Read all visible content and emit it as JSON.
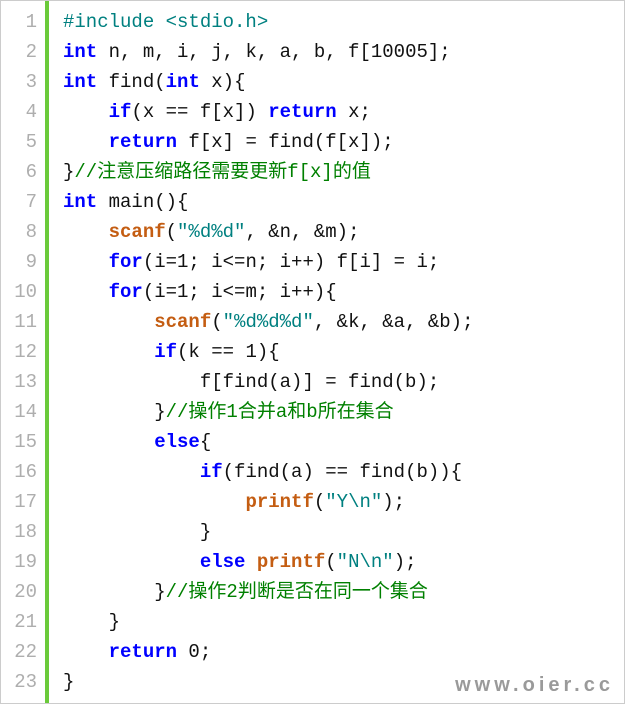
{
  "line_numbers": [
    "1",
    "2",
    "3",
    "4",
    "5",
    "6",
    "7",
    "8",
    "9",
    "10",
    "11",
    "12",
    "13",
    "14",
    "15",
    "16",
    "17",
    "18",
    "19",
    "20",
    "21",
    "22",
    "23"
  ],
  "watermark": "www.oier.cc",
  "code": {
    "l1": {
      "a": "#include",
      "b": " <stdio.h>"
    },
    "l2": {
      "a": "int",
      "b": " n, m, i, j, k, a, b, f[10005];"
    },
    "l3": {
      "a": "int",
      "b": " find(",
      "c": "int",
      "d": " x){"
    },
    "l4": {
      "a": "    ",
      "b": "if",
      "c": "(x == f[x]) ",
      "d": "return",
      "e": " x;"
    },
    "l5": {
      "a": "    ",
      "b": "return",
      "c": " f[x] = find(f[x]);"
    },
    "l6": {
      "a": "}",
      "b": "//注意压缩路径需要更新f[x]的值"
    },
    "l7": {
      "a": "int",
      "b": " main(){"
    },
    "l8": {
      "a": "    ",
      "b": "scanf",
      "c": "(",
      "d": "\"%d%d\"",
      "e": ", &n, &m);"
    },
    "l9": {
      "a": "    ",
      "b": "for",
      "c": "(i=1; i<=n; i++) f[i] = i;"
    },
    "l10": {
      "a": "    ",
      "b": "for",
      "c": "(i=1; i<=m; i++){"
    },
    "l11": {
      "a": "        ",
      "b": "scanf",
      "c": "(",
      "d": "\"%d%d%d\"",
      "e": ", &k, &a, &b);"
    },
    "l12": {
      "a": "        ",
      "b": "if",
      "c": "(k == 1){"
    },
    "l13": {
      "a": "            f[find(a)] = find(b);"
    },
    "l14": {
      "a": "        }",
      "b": "//操作1合并a和b所在集合"
    },
    "l15": {
      "a": "        ",
      "b": "else",
      "c": "{"
    },
    "l16": {
      "a": "            ",
      "b": "if",
      "c": "(find(a) == find(b)){"
    },
    "l17": {
      "a": "                ",
      "b": "printf",
      "c": "(",
      "d": "\"Y\\n\"",
      "e": ");"
    },
    "l18": {
      "a": "            }"
    },
    "l19": {
      "a": "            ",
      "b": "else",
      "c": " ",
      "d": "printf",
      "e": "(",
      "f": "\"N\\n\"",
      "g": ");"
    },
    "l20": {
      "a": "        }",
      "b": "//操作2判断是否在同一个集合"
    },
    "l21": {
      "a": "    }"
    },
    "l22": {
      "a": "    ",
      "b": "return",
      "c": " 0;"
    },
    "l23": {
      "a": "}"
    }
  }
}
